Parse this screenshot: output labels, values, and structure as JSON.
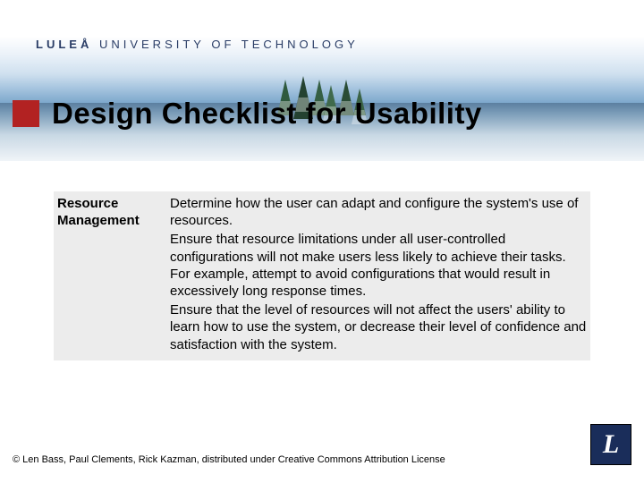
{
  "university": {
    "bold": "LULEÅ",
    "rest": " UNIVERSITY OF TECHNOLOGY"
  },
  "title": "Design Checklist for Usability",
  "table": {
    "heading": "Resource Management",
    "p1": "Determine how the user can adapt and configure the system's use of resources.",
    "p2": "Ensure that resource limitations under all user-controlled configurations will not make users less likely to achieve their tasks.  For example, attempt to avoid configurations that would result in excessively long response times.",
    "p3": "Ensure that the level of resources will not affect the users' ability to learn how to use the system, or decrease their level of confidence and satisfaction with the system."
  },
  "attribution": "© Len Bass, Paul Clements, Rick Kazman, distributed under Creative Commons Attribution License",
  "logo_letter": "L"
}
